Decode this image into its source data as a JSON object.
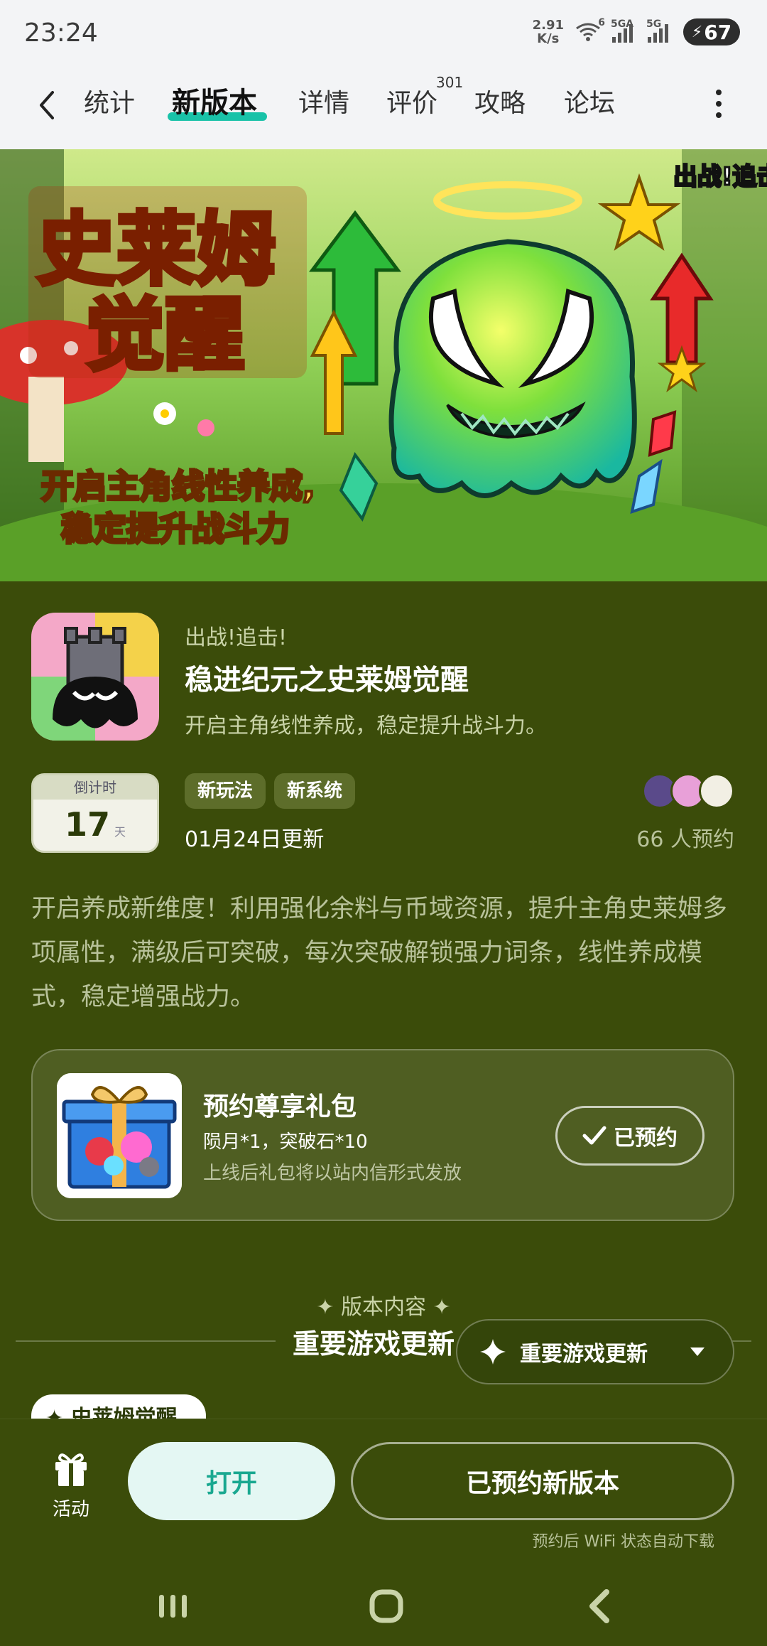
{
  "status_bar": {
    "time": "23:24",
    "net_speed_value": "2.91",
    "net_speed_unit": "K/s",
    "wifi_badge": "6",
    "sim1_label": "5GA",
    "sim2_label": "5G",
    "battery": "67"
  },
  "tabs": [
    {
      "label": "统计"
    },
    {
      "label": "新版本"
    },
    {
      "label": "详情"
    },
    {
      "label": "评价"
    },
    {
      "label": "攻略"
    },
    {
      "label": "论坛"
    }
  ],
  "review_count": "301",
  "banner": {
    "logo_title_line1": "史莱姆",
    "logo_title_line2": "觉醒",
    "slogan_line1": "开启主角线性养成,",
    "slogan_line2": "稳定提升战斗力",
    "corner_logo": "出战!追击"
  },
  "app": {
    "subtitle": "出战!追击!",
    "title": "稳进纪元之史莱姆觉醒",
    "description": "开启主角线性养成，稳定提升战斗力。"
  },
  "countdown": {
    "label": "倒计时",
    "days": "17",
    "unit": "天"
  },
  "tags": [
    "新玩法",
    "新系统"
  ],
  "update_date": "01月24日更新",
  "reserve_count": "66 人预约",
  "long_description": "开启养成新维度！利用强化余料与币域资源，提升主角史莱姆多项属性，满级后可突破，每次突破解锁强力词条，线性养成模式，稳定增强战力。",
  "gift": {
    "title": "预约尊享礼包",
    "items": "陨月*1，突破石*10",
    "note": "上线后礼包将以站内信形式发放",
    "button": "已预约"
  },
  "section": {
    "subtitle": "✦ 版本内容 ✦",
    "title": "重要游戏更新",
    "dropdown_label": "重要游戏更新",
    "chip": "✦ 史莱姆觉醒"
  },
  "bottom": {
    "activity_label": "活动",
    "open_button": "打开",
    "reserved_version_button": "已预约新版本",
    "wifi_note": "预约后 WiFi 状态自动下载"
  },
  "colors": {
    "accent": "#19c2a8",
    "background": "#3b4c0a"
  }
}
